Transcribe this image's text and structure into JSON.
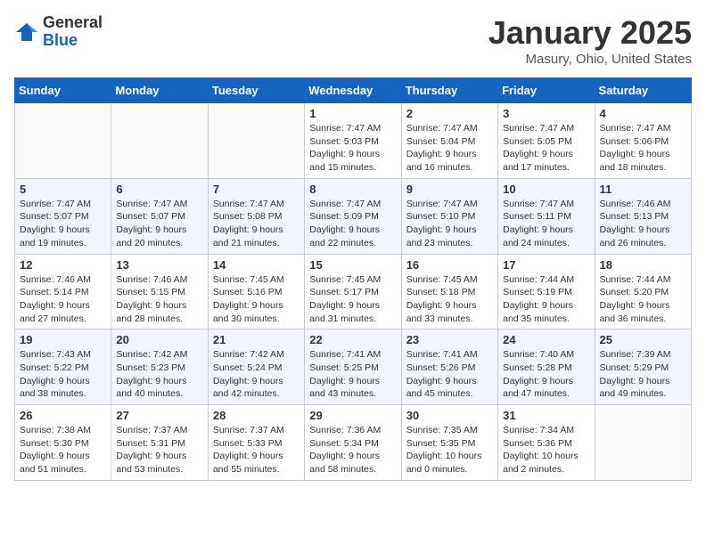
{
  "header": {
    "logo_general": "General",
    "logo_blue": "Blue",
    "month_title": "January 2025",
    "location": "Masury, Ohio, United States"
  },
  "days_of_week": [
    "Sunday",
    "Monday",
    "Tuesday",
    "Wednesday",
    "Thursday",
    "Friday",
    "Saturday"
  ],
  "weeks": [
    [
      {
        "day": "",
        "info": ""
      },
      {
        "day": "",
        "info": ""
      },
      {
        "day": "",
        "info": ""
      },
      {
        "day": "1",
        "info": "Sunrise: 7:47 AM\nSunset: 5:03 PM\nDaylight: 9 hours and 15 minutes."
      },
      {
        "day": "2",
        "info": "Sunrise: 7:47 AM\nSunset: 5:04 PM\nDaylight: 9 hours and 16 minutes."
      },
      {
        "day": "3",
        "info": "Sunrise: 7:47 AM\nSunset: 5:05 PM\nDaylight: 9 hours and 17 minutes."
      },
      {
        "day": "4",
        "info": "Sunrise: 7:47 AM\nSunset: 5:06 PM\nDaylight: 9 hours and 18 minutes."
      }
    ],
    [
      {
        "day": "5",
        "info": "Sunrise: 7:47 AM\nSunset: 5:07 PM\nDaylight: 9 hours and 19 minutes."
      },
      {
        "day": "6",
        "info": "Sunrise: 7:47 AM\nSunset: 5:07 PM\nDaylight: 9 hours and 20 minutes."
      },
      {
        "day": "7",
        "info": "Sunrise: 7:47 AM\nSunset: 5:08 PM\nDaylight: 9 hours and 21 minutes."
      },
      {
        "day": "8",
        "info": "Sunrise: 7:47 AM\nSunset: 5:09 PM\nDaylight: 9 hours and 22 minutes."
      },
      {
        "day": "9",
        "info": "Sunrise: 7:47 AM\nSunset: 5:10 PM\nDaylight: 9 hours and 23 minutes."
      },
      {
        "day": "10",
        "info": "Sunrise: 7:47 AM\nSunset: 5:11 PM\nDaylight: 9 hours and 24 minutes."
      },
      {
        "day": "11",
        "info": "Sunrise: 7:46 AM\nSunset: 5:13 PM\nDaylight: 9 hours and 26 minutes."
      }
    ],
    [
      {
        "day": "12",
        "info": "Sunrise: 7:46 AM\nSunset: 5:14 PM\nDaylight: 9 hours and 27 minutes."
      },
      {
        "day": "13",
        "info": "Sunrise: 7:46 AM\nSunset: 5:15 PM\nDaylight: 9 hours and 28 minutes."
      },
      {
        "day": "14",
        "info": "Sunrise: 7:45 AM\nSunset: 5:16 PM\nDaylight: 9 hours and 30 minutes."
      },
      {
        "day": "15",
        "info": "Sunrise: 7:45 AM\nSunset: 5:17 PM\nDaylight: 9 hours and 31 minutes."
      },
      {
        "day": "16",
        "info": "Sunrise: 7:45 AM\nSunset: 5:18 PM\nDaylight: 9 hours and 33 minutes."
      },
      {
        "day": "17",
        "info": "Sunrise: 7:44 AM\nSunset: 5:19 PM\nDaylight: 9 hours and 35 minutes."
      },
      {
        "day": "18",
        "info": "Sunrise: 7:44 AM\nSunset: 5:20 PM\nDaylight: 9 hours and 36 minutes."
      }
    ],
    [
      {
        "day": "19",
        "info": "Sunrise: 7:43 AM\nSunset: 5:22 PM\nDaylight: 9 hours and 38 minutes."
      },
      {
        "day": "20",
        "info": "Sunrise: 7:42 AM\nSunset: 5:23 PM\nDaylight: 9 hours and 40 minutes."
      },
      {
        "day": "21",
        "info": "Sunrise: 7:42 AM\nSunset: 5:24 PM\nDaylight: 9 hours and 42 minutes."
      },
      {
        "day": "22",
        "info": "Sunrise: 7:41 AM\nSunset: 5:25 PM\nDaylight: 9 hours and 43 minutes."
      },
      {
        "day": "23",
        "info": "Sunrise: 7:41 AM\nSunset: 5:26 PM\nDaylight: 9 hours and 45 minutes."
      },
      {
        "day": "24",
        "info": "Sunrise: 7:40 AM\nSunset: 5:28 PM\nDaylight: 9 hours and 47 minutes."
      },
      {
        "day": "25",
        "info": "Sunrise: 7:39 AM\nSunset: 5:29 PM\nDaylight: 9 hours and 49 minutes."
      }
    ],
    [
      {
        "day": "26",
        "info": "Sunrise: 7:38 AM\nSunset: 5:30 PM\nDaylight: 9 hours and 51 minutes."
      },
      {
        "day": "27",
        "info": "Sunrise: 7:37 AM\nSunset: 5:31 PM\nDaylight: 9 hours and 53 minutes."
      },
      {
        "day": "28",
        "info": "Sunrise: 7:37 AM\nSunset: 5:33 PM\nDaylight: 9 hours and 55 minutes."
      },
      {
        "day": "29",
        "info": "Sunrise: 7:36 AM\nSunset: 5:34 PM\nDaylight: 9 hours and 58 minutes."
      },
      {
        "day": "30",
        "info": "Sunrise: 7:35 AM\nSunset: 5:35 PM\nDaylight: 10 hours and 0 minutes."
      },
      {
        "day": "31",
        "info": "Sunrise: 7:34 AM\nSunset: 5:36 PM\nDaylight: 10 hours and 2 minutes."
      },
      {
        "day": "",
        "info": ""
      }
    ]
  ]
}
